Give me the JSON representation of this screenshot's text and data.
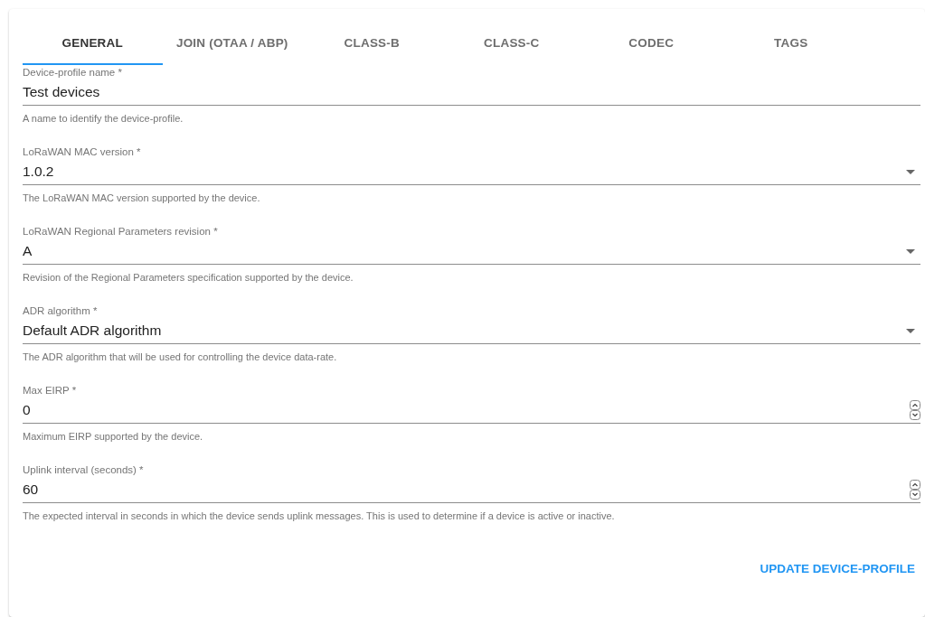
{
  "tabs": [
    {
      "label": "GENERAL",
      "selected": true
    },
    {
      "label": "JOIN (OTAA / ABP)",
      "selected": false
    },
    {
      "label": "CLASS-B",
      "selected": false
    },
    {
      "label": "CLASS-C",
      "selected": false
    },
    {
      "label": "CODEC",
      "selected": false
    },
    {
      "label": "TAGS",
      "selected": false
    }
  ],
  "fields": [
    {
      "kind": "text",
      "label": "Device-profile name *",
      "value": "Test devices",
      "helper": "A name to identify the device-profile."
    },
    {
      "kind": "select",
      "label": "LoRaWAN MAC version *",
      "value": "1.0.2",
      "helper": "The LoRaWAN MAC version supported by the device."
    },
    {
      "kind": "select",
      "label": "LoRaWAN Regional Parameters revision *",
      "value": "A",
      "helper": "Revision of the Regional Parameters specification supported by the device."
    },
    {
      "kind": "select",
      "label": "ADR algorithm *",
      "value": "Default ADR algorithm",
      "helper": "The ADR algorithm that will be used for controlling the device data-rate."
    },
    {
      "kind": "number",
      "label": "Max EIRP *",
      "value": "0",
      "helper": "Maximum EIRP supported by the device."
    },
    {
      "kind": "number",
      "label": "Uplink interval (seconds) *",
      "value": "60",
      "helper": "The expected interval in seconds in which the device sends uplink messages. This is used to determine if a device is active or inactive."
    }
  ],
  "submit": "UPDATE DEVICE-PROFILE"
}
